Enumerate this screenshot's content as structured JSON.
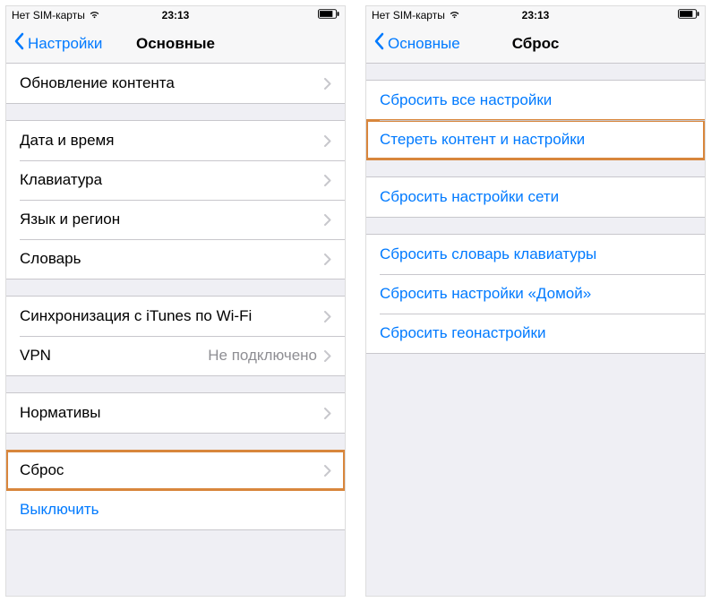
{
  "left": {
    "status": {
      "carrier": "Нет SIM-карты",
      "time": "23:13"
    },
    "nav": {
      "back": "Настройки",
      "title": "Основные"
    },
    "groups": [
      {
        "first": true,
        "rows": [
          {
            "label": "Обновление контента",
            "chevron": true
          }
        ]
      },
      {
        "rows": [
          {
            "label": "Дата и время",
            "chevron": true
          },
          {
            "label": "Клавиатура",
            "chevron": true
          },
          {
            "label": "Язык и регион",
            "chevron": true
          },
          {
            "label": "Словарь",
            "chevron": true
          }
        ]
      },
      {
        "rows": [
          {
            "label": "Синхронизация с iTunes по Wi-Fi",
            "chevron": true
          },
          {
            "label": "VPN",
            "value": "Не подключено",
            "chevron": true
          }
        ]
      },
      {
        "rows": [
          {
            "label": "Нормативы",
            "chevron": true
          }
        ]
      },
      {
        "rows": [
          {
            "label": "Сброс",
            "chevron": true,
            "highlight": true
          },
          {
            "label": "Выключить",
            "link": true
          }
        ]
      }
    ]
  },
  "right": {
    "status": {
      "carrier": "Нет SIM-карты",
      "time": "23:13"
    },
    "nav": {
      "back": "Основные",
      "title": "Сброс"
    },
    "groups": [
      {
        "rows": [
          {
            "label": "Сбросить все настройки",
            "link": true
          },
          {
            "label": "Стереть контент и настройки",
            "link": true,
            "highlight": true
          }
        ]
      },
      {
        "rows": [
          {
            "label": "Сбросить настройки сети",
            "link": true
          }
        ]
      },
      {
        "rows": [
          {
            "label": "Сбросить словарь клавиатуры",
            "link": true
          },
          {
            "label": "Сбросить настройки «Домой»",
            "link": true
          },
          {
            "label": "Сбросить геонастройки",
            "link": true
          }
        ]
      }
    ]
  }
}
